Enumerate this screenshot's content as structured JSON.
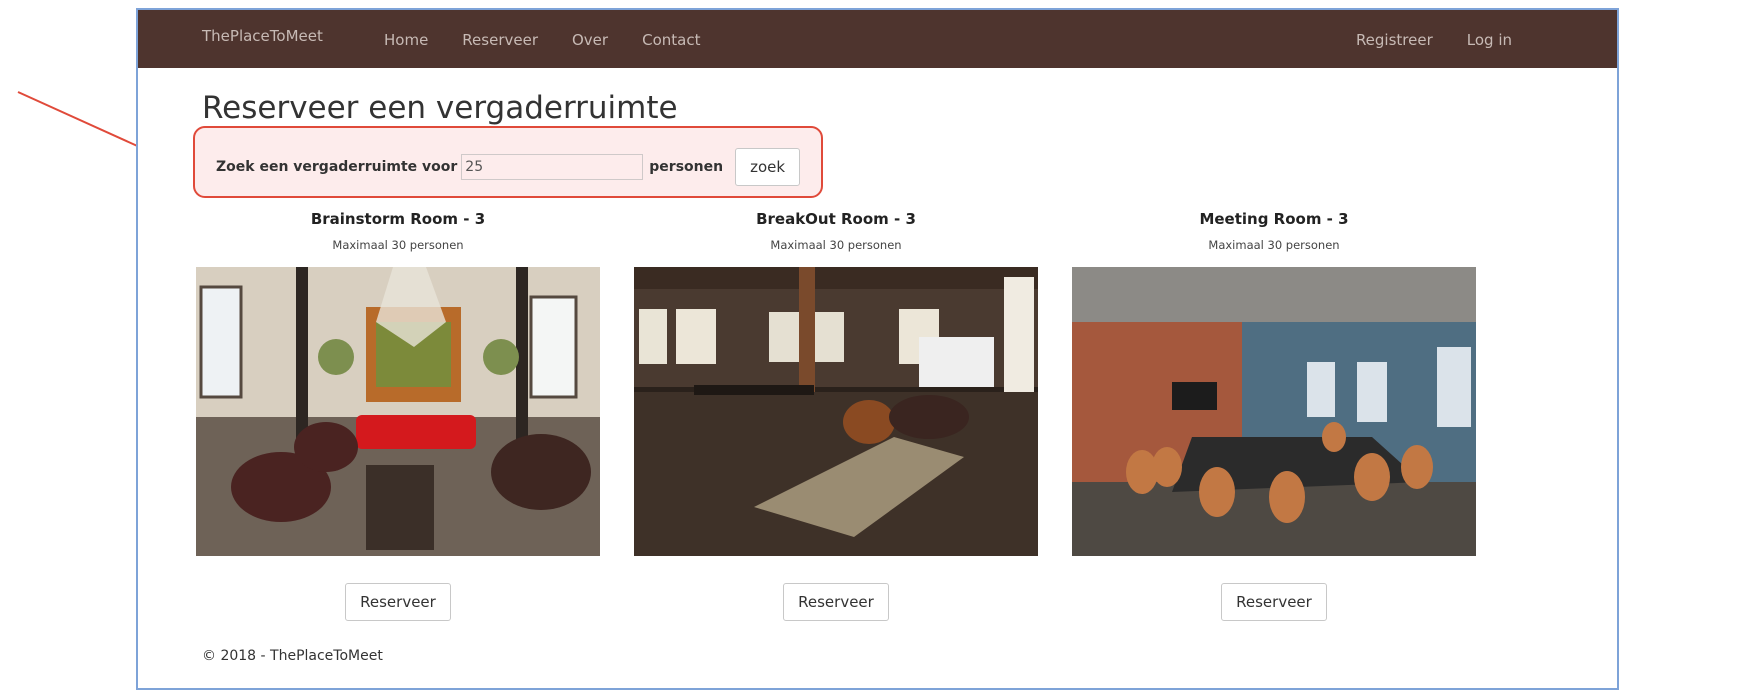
{
  "navbar": {
    "brand": "ThePlaceToMeet",
    "links_left": [
      "Home",
      "Reserveer",
      "Over",
      "Contact"
    ],
    "links_right": [
      "Registreer",
      "Log in"
    ],
    "bg_color": "#4e342e"
  },
  "page": {
    "title": "Reserveer een vergaderruimte"
  },
  "search": {
    "label_before": "Zoek een vergaderruimte voor",
    "value": "25",
    "label_after": "personen",
    "button_label": "zoek"
  },
  "rooms": [
    {
      "name": "Brainstorm Room - 3",
      "capacity": "Maximaal 30 personen",
      "image": "lounge-with-chandelier-and-red-sofa",
      "button_label": "Reserveer"
    },
    {
      "name": "BreakOut Room - 3",
      "capacity": "Maximaal 30 personen",
      "image": "loft-with-wooden-floor-and-armchairs",
      "button_label": "Reserveer"
    },
    {
      "name": "Meeting Room - 3",
      "capacity": "Maximaal 30 personen",
      "image": "meeting-table-with-orange-chairs-brick-wall",
      "button_label": "Reserveer"
    }
  ],
  "footer": {
    "text": "© 2018 - ThePlaceToMeet"
  },
  "annotation": {
    "highlight_color": "#e04a3a"
  }
}
